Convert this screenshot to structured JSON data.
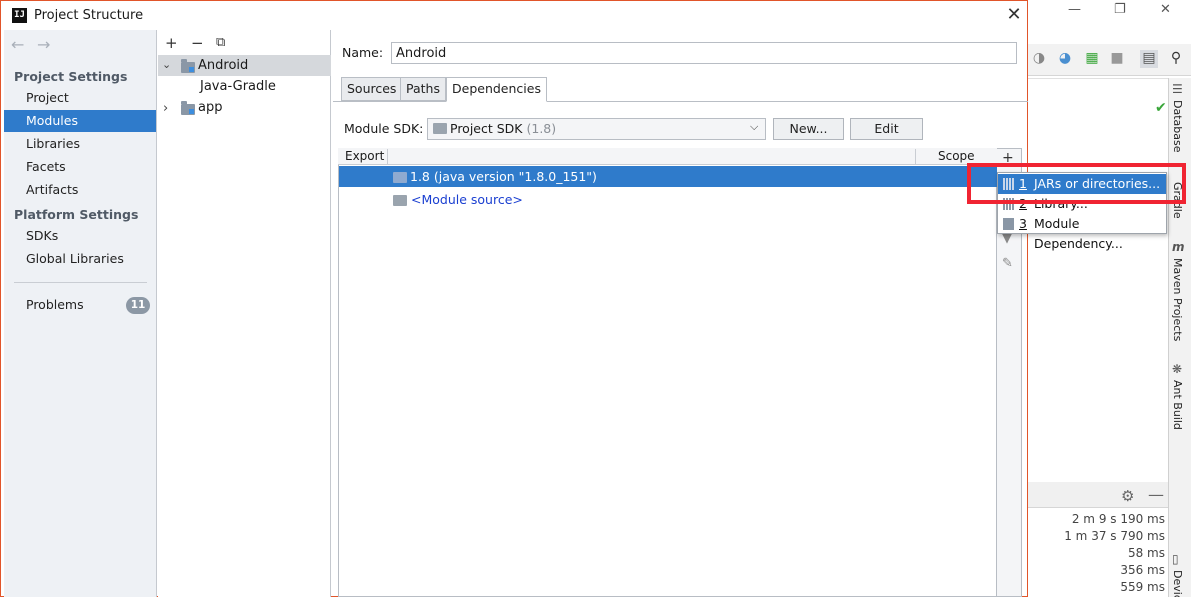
{
  "dialog": {
    "title": "Project Structure",
    "app_icon_text": "IJ"
  },
  "nav": {
    "section_project": "Project Settings",
    "section_platform": "Platform Settings",
    "items": [
      "Project",
      "Modules",
      "Libraries",
      "Facets",
      "Artifacts"
    ],
    "platform_items": [
      "SDKs",
      "Global Libraries"
    ],
    "selected": "Modules",
    "problems_label": "Problems",
    "problems_count": "11"
  },
  "tree": {
    "root": "Android",
    "child": "Java-Gradle",
    "app": "app"
  },
  "module": {
    "name_label": "Name:",
    "name_value": "Android",
    "tabs": [
      "Sources",
      "Paths",
      "Dependencies"
    ],
    "active_tab": "Dependencies",
    "sdk_label": "Module SDK:",
    "sdk_value": "Project SDK",
    "sdk_version": "(1.8)",
    "new_button": "New...",
    "edit_button": "Edit"
  },
  "dependencies": {
    "columns": [
      "Export",
      "Scope"
    ],
    "rows": [
      "1.8 (java version \"1.8.0_151\")",
      "<Module source>"
    ]
  },
  "popup": {
    "items": [
      {
        "num": "1",
        "label": "JARs or directories..."
      },
      {
        "num": "2",
        "label": "Library..."
      },
      {
        "num": "3",
        "label": "Module Dependency..."
      }
    ]
  },
  "ide": {
    "side_tabs": [
      "Database",
      "Gradle",
      "Maven Projects",
      "Ant Build",
      "Device"
    ],
    "build_times": [
      "2 m 9 s 190 ms",
      "1 m 37 s 790 ms",
      "58 ms",
      "356 ms",
      "559 ms"
    ]
  },
  "colors": {
    "selection": "#2f7bcb",
    "highlight": "#f02432",
    "dialog_border": "#e1552a",
    "link": "#1a3fd1"
  }
}
